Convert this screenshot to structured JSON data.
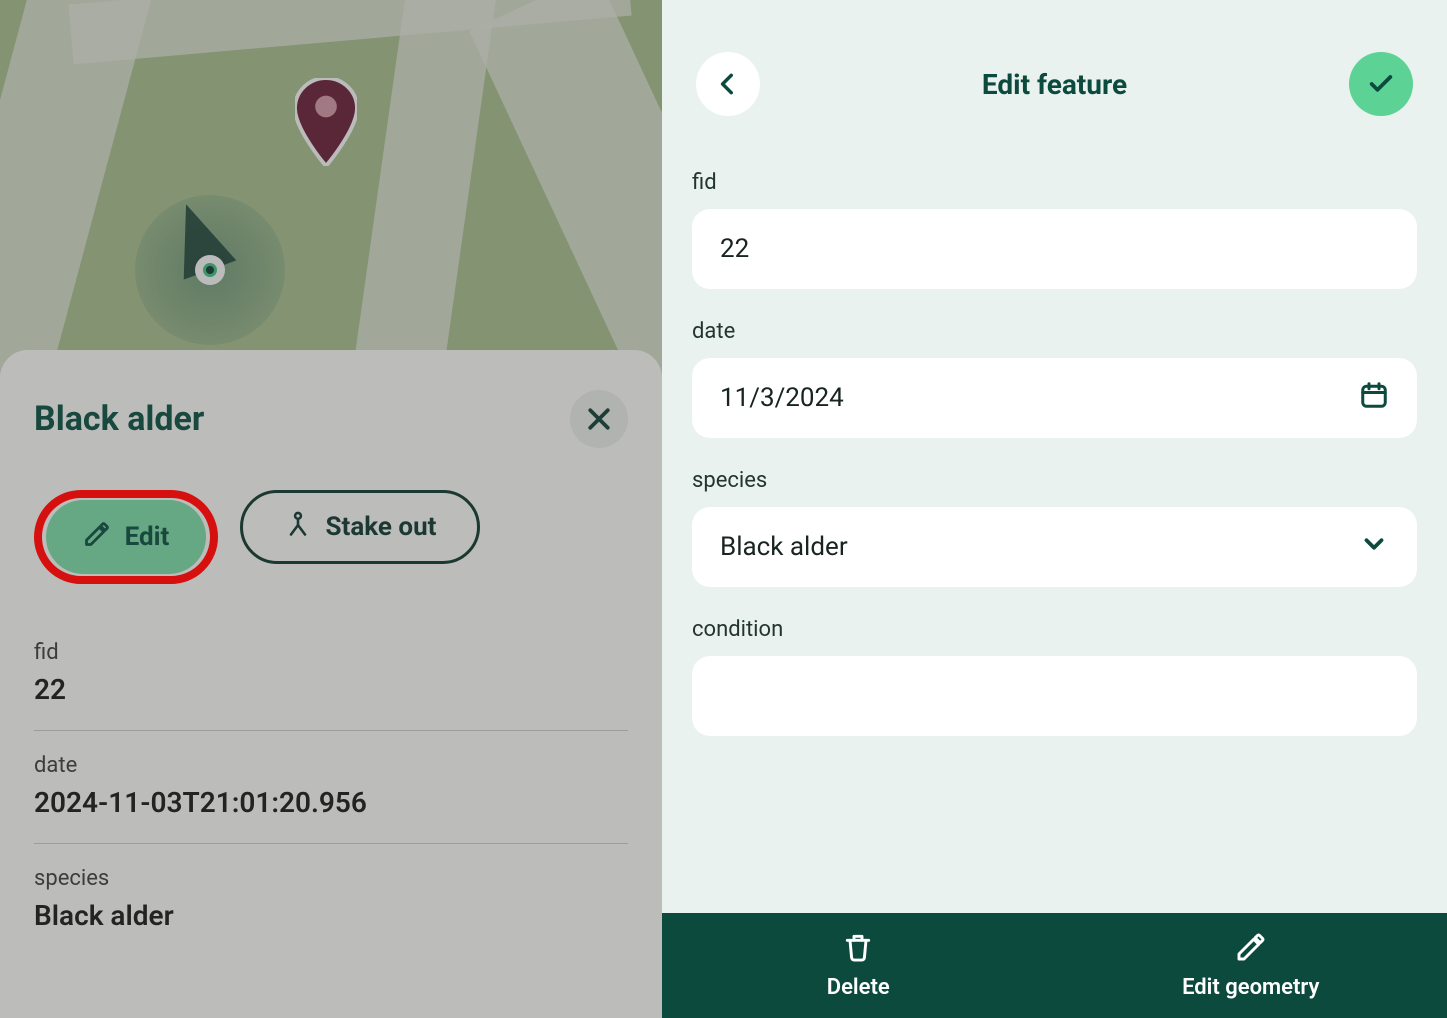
{
  "left": {
    "sheet": {
      "title": "Black alder",
      "edit_label": "Edit",
      "stake_label": "Stake out",
      "fields": {
        "fid_label": "fid",
        "fid_value": "22",
        "date_label": "date",
        "date_value": "2024-11-03T21:01:20.956",
        "species_label": "species",
        "species_value": "Black alder"
      }
    }
  },
  "right": {
    "title": "Edit feature",
    "form": {
      "fid_label": "fid",
      "fid_value": "22",
      "date_label": "date",
      "date_value": "11/3/2024",
      "species_label": "species",
      "species_value": "Black alder",
      "condition_label": "condition",
      "condition_value": ""
    },
    "bottom": {
      "delete_label": "Delete",
      "editgeom_label": "Edit geometry"
    }
  }
}
